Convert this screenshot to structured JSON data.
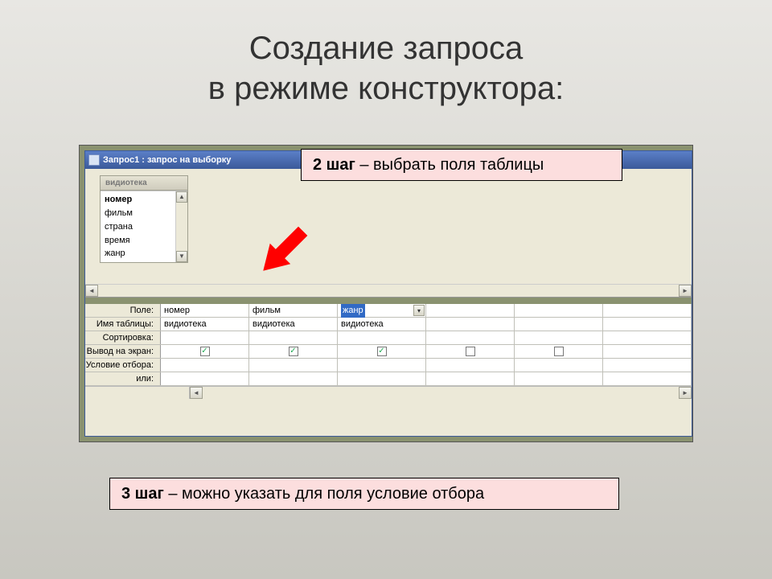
{
  "slide": {
    "title_line1": "Создание запроса",
    "title_line2": "в режиме конструктора:"
  },
  "window": {
    "title": "Запрос1 : запрос на выборку"
  },
  "source_table": {
    "name": "видиотека",
    "fields": [
      "номер",
      "фильм",
      "страна",
      "время",
      "жанр"
    ],
    "selected_index": 0
  },
  "design_grid": {
    "row_labels": [
      "Поле:",
      "Имя таблицы:",
      "Сортировка:",
      "Вывод на экран:",
      "Условие отбора:",
      "или:"
    ],
    "columns": [
      {
        "field": "номер",
        "table": "видиотека",
        "sort": "",
        "show": true,
        "criteria": "",
        "or": "",
        "selected": false
      },
      {
        "field": "фильм",
        "table": "видиотека",
        "sort": "",
        "show": true,
        "criteria": "",
        "or": "",
        "selected": false
      },
      {
        "field": "жанр",
        "table": "видиотека",
        "sort": "",
        "show": true,
        "criteria": "",
        "or": "",
        "selected": true
      },
      {
        "field": "",
        "table": "",
        "sort": "",
        "show": false,
        "criteria": "",
        "or": "",
        "selected": false
      },
      {
        "field": "",
        "table": "",
        "sort": "",
        "show": false,
        "criteria": "",
        "or": "",
        "selected": false
      }
    ]
  },
  "callouts": {
    "step2_bold": "2 шаг",
    "step2_rest": " – выбрать поля таблицы",
    "step3_bold": "3 шаг",
    "step3_rest": " – можно указать для поля условие отбора"
  },
  "colors": {
    "callout_bg": "#fcdede",
    "arrow": "#ff0000"
  }
}
